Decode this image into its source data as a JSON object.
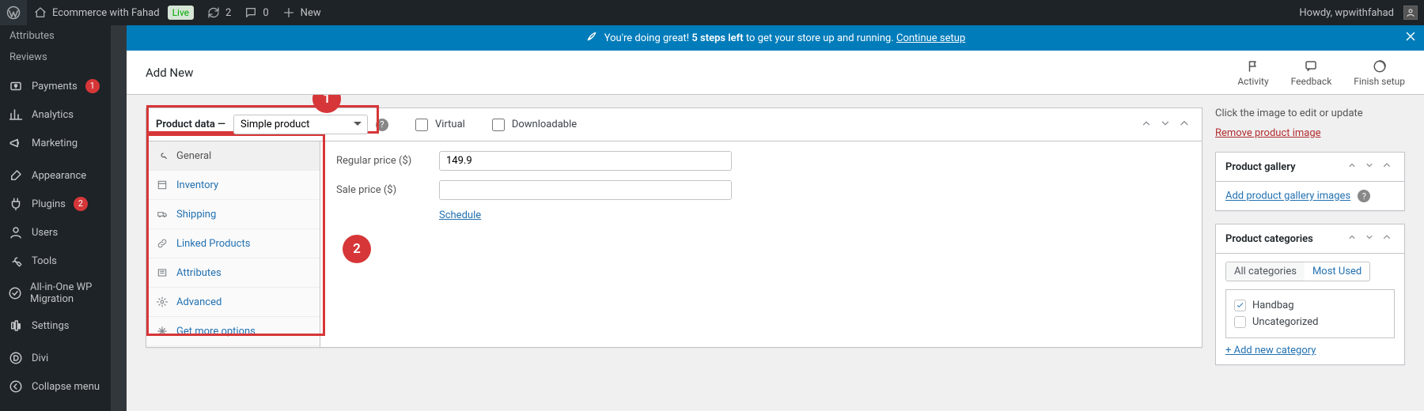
{
  "toolbar": {
    "site_name": "Ecommerce with Fahad",
    "live": "Live",
    "updates": "2",
    "comments": "0",
    "new": "New",
    "howdy": "Howdy, wpwithfahad"
  },
  "admin_menu": {
    "sub1": "Attributes",
    "sub2": "Reviews",
    "items": [
      {
        "icon": "dollar",
        "label": "Payments",
        "badge": "1"
      },
      {
        "icon": "chart",
        "label": "Analytics"
      },
      {
        "icon": "megaphone",
        "label": "Marketing"
      },
      {
        "icon": "brush",
        "label": "Appearance"
      },
      {
        "icon": "plug",
        "label": "Plugins",
        "badge": "2"
      },
      {
        "icon": "users",
        "label": "Users"
      },
      {
        "icon": "wrench",
        "label": "Tools"
      },
      {
        "icon": "migrate",
        "label": "All-in-One WP Migration"
      },
      {
        "icon": "settings",
        "label": "Settings"
      },
      {
        "icon": "divi",
        "label": "Divi"
      },
      {
        "icon": "collapse",
        "label": "Collapse menu"
      }
    ]
  },
  "banner": {
    "pre": "You're doing great! ",
    "bold": "5 steps left",
    "post": " to get your store up and running. ",
    "link": "Continue setup"
  },
  "header": {
    "title": "Add New",
    "activity": "Activity",
    "feedback": "Feedback",
    "finish": "Finish setup"
  },
  "product_data": {
    "label": "Product data —",
    "select": "Simple product",
    "virtual": "Virtual",
    "downloadable": "Downloadable",
    "tabs": {
      "general": "General",
      "inventory": "Inventory",
      "shipping": "Shipping",
      "linked": "Linked Products",
      "attributes": "Attributes",
      "advanced": "Advanced",
      "more": "Get more options"
    },
    "fields": {
      "regular_label": "Regular price ($)",
      "regular_value": "149.9",
      "sale_label": "Sale price ($)",
      "sale_value": "",
      "schedule": "Schedule"
    }
  },
  "annotation": {
    "one": "1",
    "two": "2"
  },
  "side": {
    "img_hint": "Click the image to edit or update",
    "remove": "Remove product image",
    "gallery_title": "Product gallery",
    "gallery_link": "Add product gallery images",
    "cat_title": "Product categories",
    "tab_all": "All categories",
    "tab_most": "Most Used",
    "cat1": "Handbag",
    "cat2": "Uncategorized",
    "add_cat": "+ Add new category"
  }
}
